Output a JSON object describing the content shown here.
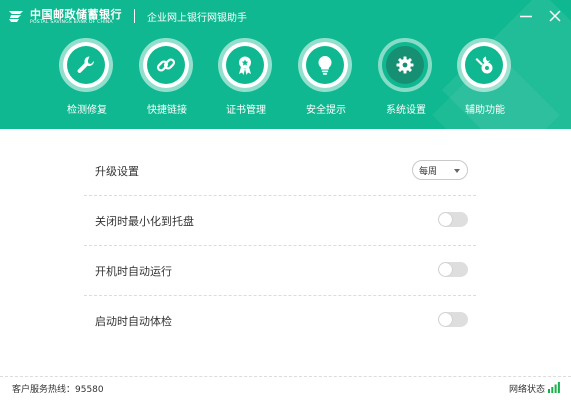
{
  "header": {
    "logo_cn": "中国邮政储蓄银行",
    "logo_en": "POSTAL SAVINGS BANK OF CHINA",
    "app_title": "企业网上银行网银助手",
    "bg_color": "#0fb890",
    "active_bg": "#178f72"
  },
  "nav": [
    {
      "label": "检测修复",
      "icon": "wrench-icon"
    },
    {
      "label": "快捷链接",
      "icon": "link-icon"
    },
    {
      "label": "证书管理",
      "icon": "certificate-icon"
    },
    {
      "label": "安全提示",
      "icon": "lightbulb-icon"
    },
    {
      "label": "系统设置",
      "icon": "gear-icon",
      "active": true
    },
    {
      "label": "辅助功能",
      "icon": "tools-icon"
    }
  ],
  "settings": {
    "upgrade": {
      "label": "升级设置",
      "selected": "每周"
    },
    "minimize_tray": {
      "label": "关闭时最小化到托盘",
      "on": false
    },
    "auto_run": {
      "label": "开机时自动运行",
      "on": false
    },
    "auto_check": {
      "label": "启动时自动体检",
      "on": false
    }
  },
  "footer": {
    "hotline": "客户服务热线：95580",
    "network": "网络状态",
    "signal_color": "#17b04a"
  }
}
